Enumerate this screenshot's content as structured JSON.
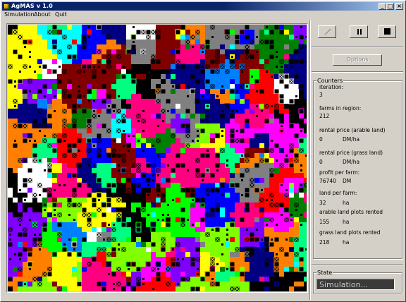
{
  "window": {
    "title": "AgMAS v 1.0",
    "buttons": {
      "minimize": "_",
      "maximize": "□",
      "close": "×"
    }
  },
  "menu": [
    {
      "label": "Simulation"
    },
    {
      "label": "About"
    },
    {
      "label": "Quit"
    }
  ],
  "controls": {
    "play_icon": "play-icon",
    "pause_icon": "pause-icon",
    "stop_icon": "stop-icon",
    "options_label": "Options"
  },
  "counters": {
    "title": "Counters",
    "items": [
      {
        "label": "iteration:",
        "value": "3",
        "unit": ""
      },
      {
        "label": "farms in region:",
        "value": "212",
        "unit": ""
      },
      {
        "label": "rental price (arable land)",
        "value": "0",
        "unit": "DM/ha"
      },
      {
        "label": "rental price (grass land)",
        "value": "0",
        "unit": "DM/ha"
      },
      {
        "label": "profit per farm:",
        "value": "76740",
        "unit": "DM"
      },
      {
        "label": "land per farm:",
        "value": "32",
        "unit": "ha"
      },
      {
        "label": "arable land plots rented",
        "value": "155",
        "unit": "ha"
      },
      {
        "label": "grass land plots rented",
        "value": "218",
        "unit": "ha"
      }
    ]
  },
  "state": {
    "title": "State",
    "value": "Simulation..."
  },
  "map": {
    "palette": [
      "#ff00ff",
      "#00ff00",
      "#0000ff",
      "#ff0000",
      "#00ffff",
      "#ffff00",
      "#ff8000",
      "#8000ff",
      "#008000",
      "#800000",
      "#000080",
      "#ff0080",
      "#00ff80",
      "#80ff00",
      "#0080ff",
      "#808080",
      "#ffffff"
    ],
    "background": "#000000"
  }
}
